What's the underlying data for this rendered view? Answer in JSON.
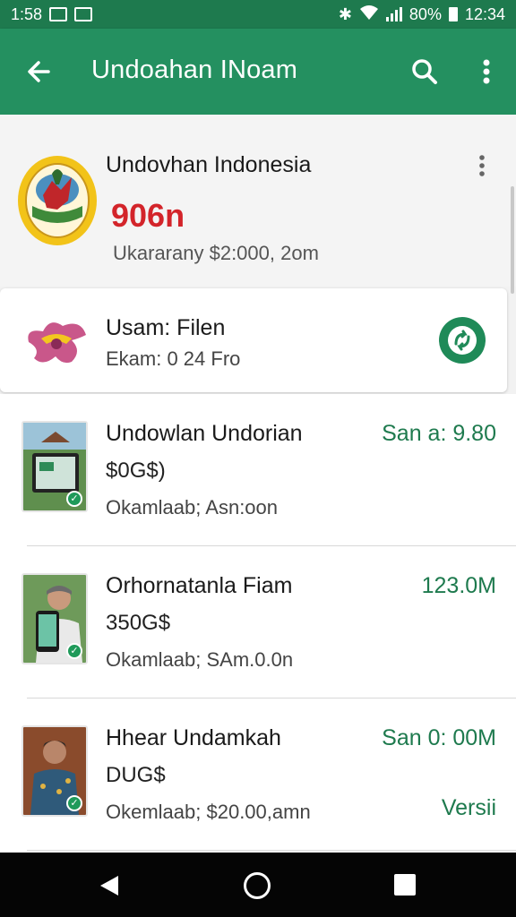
{
  "status_bar": {
    "time_left": "1:58",
    "battery": "80%",
    "time_right": "12:34"
  },
  "app_bar": {
    "title": "Undoahan INoam",
    "icons": [
      "back-arrow-icon",
      "search-icon",
      "more-vert-icon"
    ]
  },
  "header": {
    "title": "Undovhan Indonesia",
    "number": "906n",
    "subtitle": "Ukararany $2:000, 2om"
  },
  "highlight": {
    "title": "Usam: Filen",
    "subtitle": "Ekam: 0 24 Fro",
    "action_icon": "sync-icon"
  },
  "list": [
    {
      "title": "Undowlan Undorian",
      "subtitle": "$0G$)",
      "meta": "Okamlaab; Asn:oon",
      "value": "San a: 9.80",
      "tag": ""
    },
    {
      "title": "Orhornatanla Fiam",
      "subtitle": "350G$",
      "meta": "Okamlaab; SAm.0.0n",
      "value": "123.0M",
      "tag": ""
    },
    {
      "title": "Hhear Undamkah",
      "subtitle": "DUG$",
      "meta": "Okemlaab; $20.00,amn",
      "value": "San 0: 00M",
      "tag": "Versii"
    }
  ],
  "colors": {
    "primary": "#249060",
    "status_bar": "#1e7a4e",
    "accent_red": "#d3242a",
    "accent_green_text": "#1e7a4e"
  }
}
